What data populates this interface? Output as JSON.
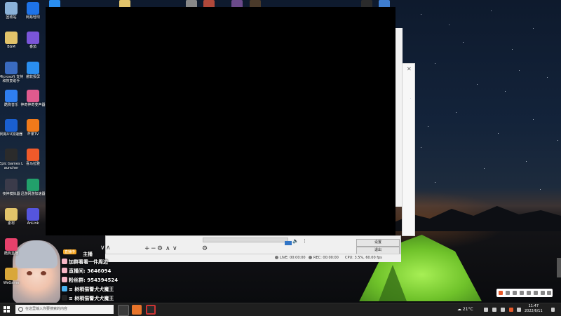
{
  "desktop": {
    "icons_left": [
      {
        "label": "回收站",
        "color": "#8ab1d8"
      },
      {
        "label": "BGM",
        "color": "#e2c36a"
      },
      {
        "label": "Microsoft 支持和恢复助手",
        "color": "#3a6bc0"
      },
      {
        "label": "酷狗音乐",
        "color": "#2f7ef0"
      },
      {
        "label": "网易UU加速器",
        "color": "#1a5fd0"
      },
      {
        "label": "Epic Games Launcher",
        "color": "#2b2b2b"
      },
      {
        "label": "夜神模拟器",
        "color": "#3b3b4a"
      },
      {
        "label": "素材",
        "color": "#e2c36a"
      },
      {
        "label": "酷狗直播",
        "color": "#e7416b"
      },
      {
        "label": "WeGame",
        "color": "#d9a73a"
      }
    ],
    "icons_right": [
      {
        "label": "网易轻呗",
        "color": "#1e73e8"
      },
      {
        "label": "番茄",
        "color": "#7a55d8"
      },
      {
        "label": "傲软投屏",
        "color": "#2a8ef0"
      },
      {
        "label": "神奇神奇变声器",
        "color": "#e05a8e"
      },
      {
        "label": "芒果TV",
        "color": "#f07a1a"
      },
      {
        "label": "喜马拉雅",
        "color": "#f05a2a"
      },
      {
        "label": "迅游网游加速器",
        "color": "#22a06b"
      },
      {
        "label": "AnLink",
        "color": "#5555dd"
      }
    ]
  },
  "obs": {
    "buttons": {
      "settings": "设置",
      "exit": "退出"
    },
    "status": {
      "live": "LIVE: 00:00:00",
      "rec": "REC: 00:00:00",
      "cpu": "CPU: 3.5%, 60.00 fps"
    },
    "controls": {
      "add": "+",
      "remove": "−",
      "gear": "⚙",
      "up": "∧",
      "down": "∨"
    }
  },
  "overlay": {
    "live_badge": "直播中",
    "title": "主播",
    "lines": [
      "加群看看一件周边",
      "直播间: 3646094",
      "粉丝群: 954394524",
      "≡ 树梢猫警犬犬魔王",
      "≡ 树梢猫警犬犬魔王"
    ]
  },
  "taskbar": {
    "search_placeholder": "在这里输入你要搜索的内容",
    "weather": "21°C",
    "time": "11:47",
    "date": "2022/6/11"
  }
}
